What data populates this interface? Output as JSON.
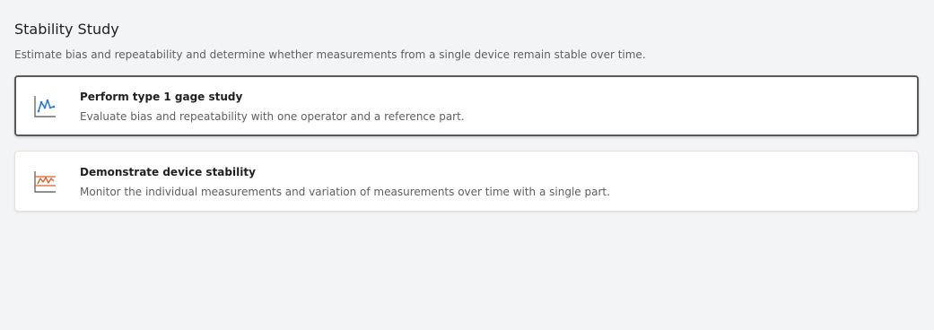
{
  "header": {
    "title": "Stability Study",
    "subtitle": "Estimate bias and repeatability and determine whether measurements from a single device remain stable over time."
  },
  "cards": [
    {
      "title": "Perform type 1 gage study",
      "description": "Evaluate bias and repeatability with one operator and a reference part.",
      "icon": "run-chart-icon",
      "icon_color": "#2b7cd3"
    },
    {
      "title": "Demonstrate device stability",
      "description": "Monitor the individual measurements and variation of measurements over time with a single part.",
      "icon": "control-chart-icon",
      "icon_color": "#d9622b"
    }
  ]
}
